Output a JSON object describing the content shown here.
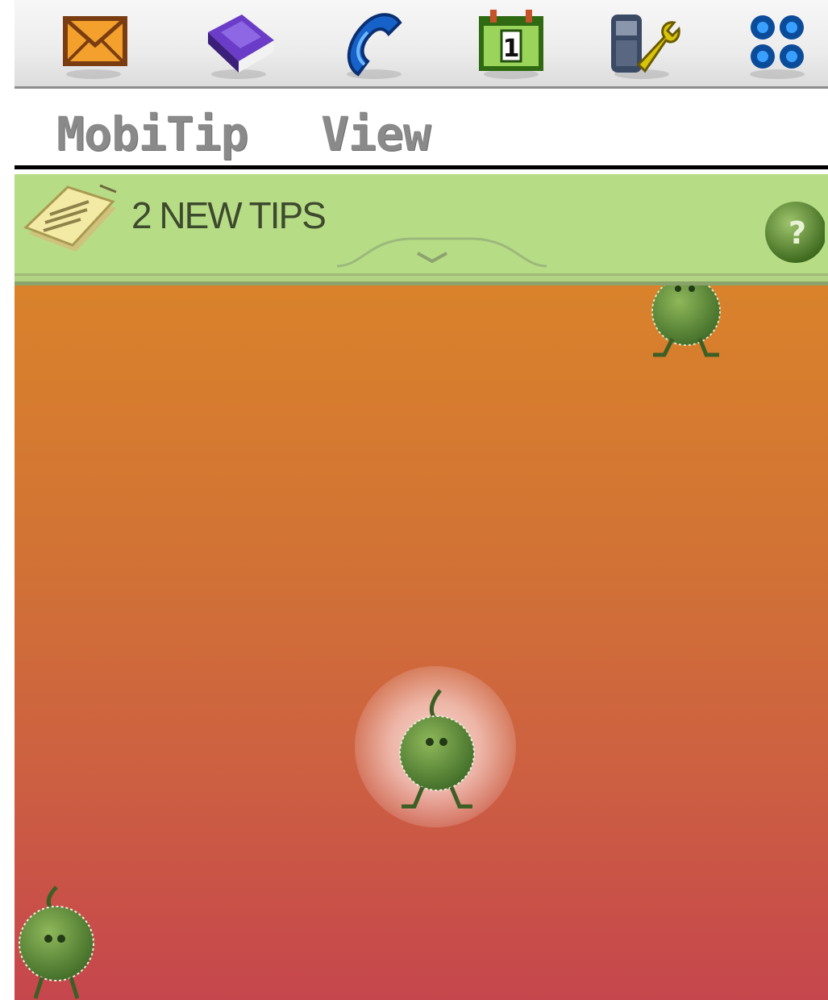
{
  "app_bar": {
    "icons": [
      {
        "name": "mail-icon"
      },
      {
        "name": "contacts-book-icon"
      },
      {
        "name": "phone-icon"
      },
      {
        "name": "calendar-icon",
        "day": "1"
      },
      {
        "name": "settings-tools-icon"
      },
      {
        "name": "apps-grid-icon"
      }
    ]
  },
  "menu": {
    "items": [
      "MobiTip",
      "View"
    ]
  },
  "tips_bar": {
    "label": "2 NEW TIPS",
    "help_symbol": "?"
  },
  "colors": {
    "tips_bar": "#b7dc86",
    "main_top": "#d9822b",
    "main_bottom": "#c6464d",
    "creature": "#6c9a3c"
  }
}
